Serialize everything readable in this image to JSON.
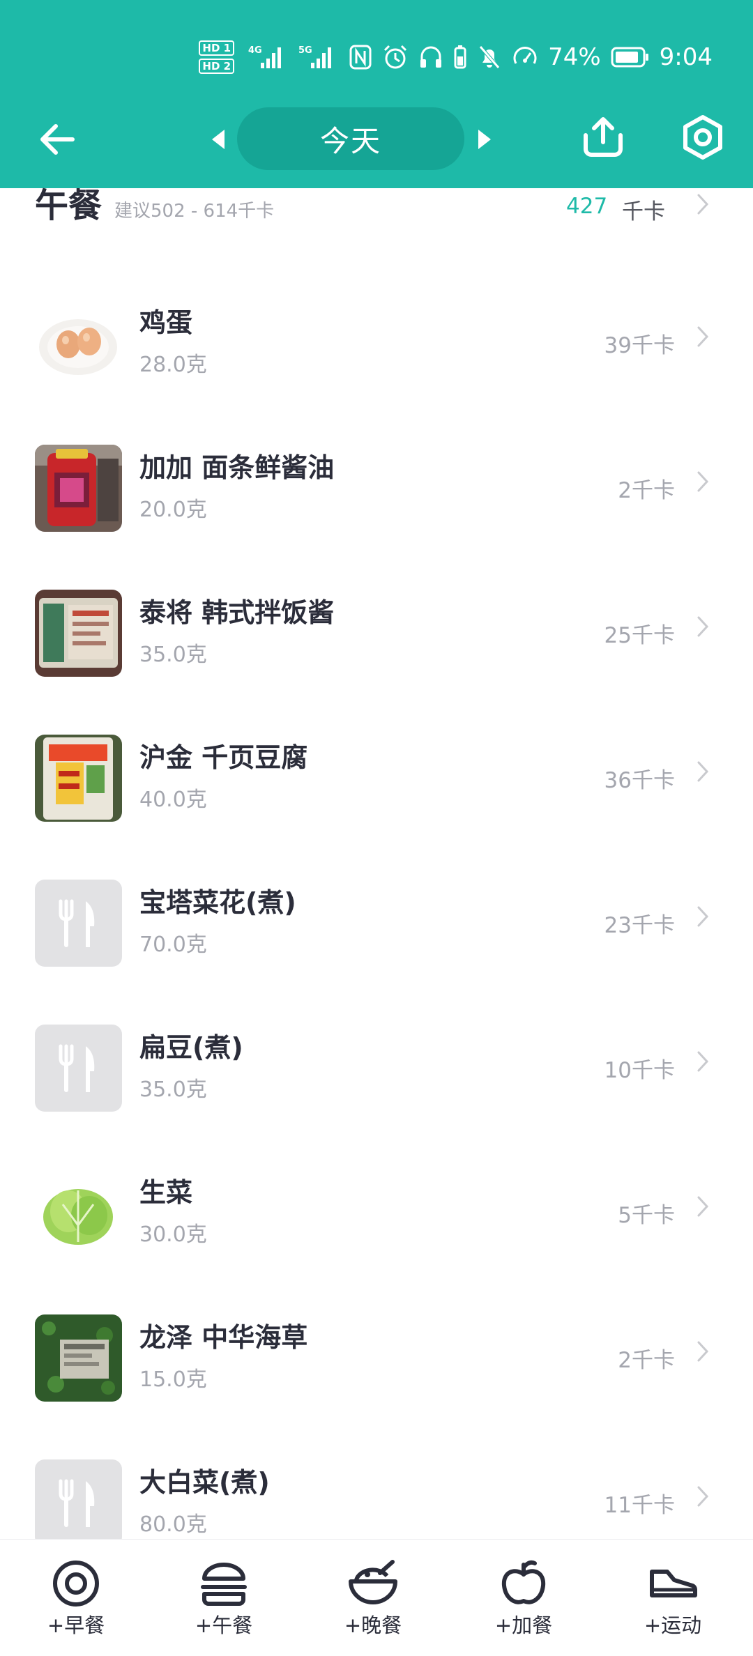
{
  "status_bar": {
    "hd1": "HD 1",
    "hd2": "HD 2",
    "net1": "4G",
    "net2": "5G",
    "battery": "74%",
    "time": "9:04"
  },
  "nav": {
    "date_label": "今天"
  },
  "meal": {
    "title": "午餐",
    "suggestion": "建议502 - 614千卡",
    "total_kcal": "427",
    "unit": "千卡"
  },
  "foods": [
    {
      "name": "鸡蛋",
      "weight": "28.0克",
      "kcal": "39千卡",
      "thumb": "egg"
    },
    {
      "name": "加加 面条鲜酱油",
      "weight": "20.0克",
      "kcal": "2千卡",
      "thumb": "soy-sauce"
    },
    {
      "name": "泰将 韩式拌饭酱",
      "weight": "35.0克",
      "kcal": "25千卡",
      "thumb": "sauce-pack"
    },
    {
      "name": "沪金 千页豆腐",
      "weight": "40.0克",
      "kcal": "36千卡",
      "thumb": "tofu-pack"
    },
    {
      "name": "宝塔菜花(煮)",
      "weight": "70.0克",
      "kcal": "23千卡",
      "thumb": "placeholder"
    },
    {
      "name": "扁豆(煮)",
      "weight": "35.0克",
      "kcal": "10千卡",
      "thumb": "placeholder"
    },
    {
      "name": "生菜",
      "weight": "30.0克",
      "kcal": "5千卡",
      "thumb": "lettuce"
    },
    {
      "name": "龙泽 中华海草",
      "weight": "15.0克",
      "kcal": "2千卡",
      "thumb": "seaweed"
    },
    {
      "name": "大白菜(煮)",
      "weight": "80.0克",
      "kcal": "11千卡",
      "thumb": "placeholder"
    }
  ],
  "bottom_nav": [
    {
      "label": "+早餐",
      "icon": "egg-icon"
    },
    {
      "label": "+午餐",
      "icon": "burger-icon"
    },
    {
      "label": "+晚餐",
      "icon": "bowl-icon"
    },
    {
      "label": "+加餐",
      "icon": "apple-icon"
    },
    {
      "label": "+运动",
      "icon": "shoe-icon"
    }
  ],
  "colors": {
    "brand": "#1ebaa8",
    "text": "#2b2d3a",
    "muted": "#a4a6ae"
  }
}
